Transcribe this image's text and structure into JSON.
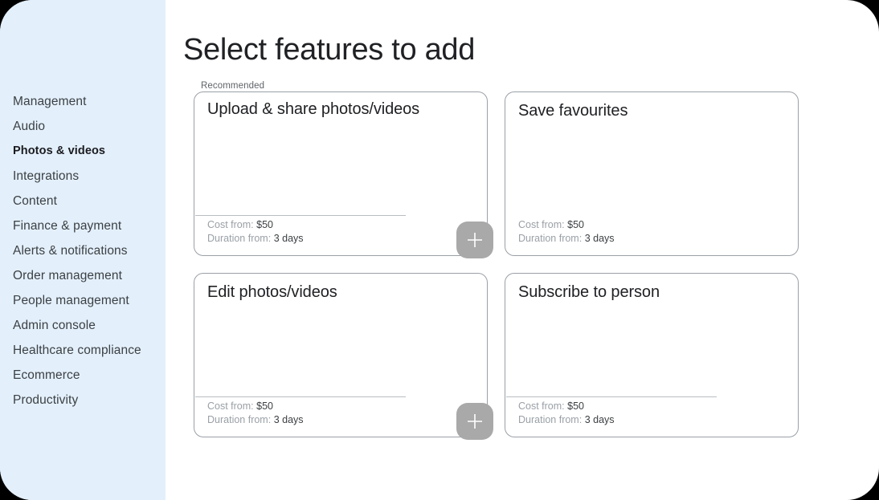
{
  "sidebar": {
    "items": [
      {
        "label": "Management",
        "active": false
      },
      {
        "label": "Audio",
        "active": false
      },
      {
        "label": "Photos & videos",
        "active": true
      },
      {
        "label": "Integrations",
        "active": false
      },
      {
        "label": "Content",
        "active": false
      },
      {
        "label": "Finance & payment",
        "active": false
      },
      {
        "label": "Alerts & notifications",
        "active": false
      },
      {
        "label": "Order management",
        "active": false
      },
      {
        "label": "People management",
        "active": false
      },
      {
        "label": "Admin console",
        "active": false
      },
      {
        "label": "Healthcare compliance",
        "active": false
      },
      {
        "label": "Ecommerce",
        "active": false
      },
      {
        "label": "Productivity",
        "active": false
      }
    ],
    "background_color": "#e3f0fc"
  },
  "main": {
    "title": "Select features to add",
    "group_label": "Recommended",
    "cost_label": "Cost from:",
    "duration_label": "Duration from:",
    "add_icon": "plus-icon",
    "add_button_color": "#a9a9a9",
    "cards": [
      {
        "title": "Upload & share photos/videos",
        "cost": "$50",
        "duration": "3 days",
        "has_divider": true,
        "has_add_button": true
      },
      {
        "title": "Save favourites",
        "cost": "$50",
        "duration": "3 days",
        "has_divider": false,
        "has_add_button": false
      },
      {
        "title": "Edit photos/videos",
        "cost": "$50",
        "duration": "3 days",
        "has_divider": true,
        "has_add_button": true
      },
      {
        "title": "Subscribe to person",
        "cost": "$50",
        "duration": "3 days",
        "has_divider": true,
        "has_add_button": false
      }
    ]
  }
}
